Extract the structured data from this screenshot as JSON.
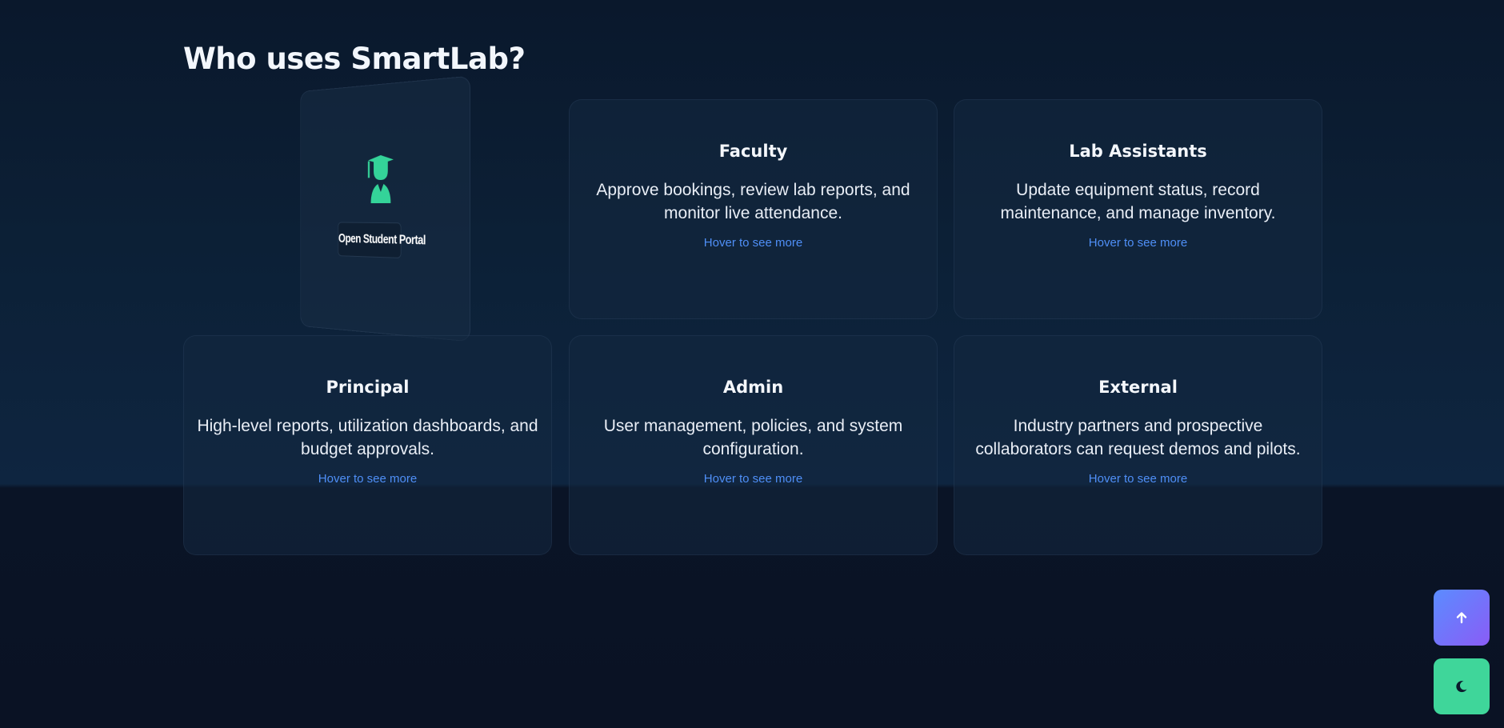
{
  "section": {
    "title": "Who uses SmartLab?"
  },
  "student_card": {
    "icon": "student-graduate-icon",
    "button_label": "Open Student Portal",
    "accent": "#34d399"
  },
  "cards": [
    {
      "title": "Faculty",
      "description": "Approve bookings, review lab reports, and monitor live attendance.",
      "hint": "Hover to see more"
    },
    {
      "title": "Lab Assistants",
      "description": "Update equipment status, record maintenance, and manage inventory.",
      "hint": "Hover to see more"
    },
    {
      "title": "Principal",
      "description": "High-level reports, utilization dashboards, and budget approvals.",
      "hint": "Hover to see more"
    },
    {
      "title": "Admin",
      "description": "User management, policies, and system configuration.",
      "hint": "Hover to see more"
    },
    {
      "title": "External",
      "description": "Industry partners and prospective collaborators can request demos and pilots.",
      "hint": "Hover to see more"
    }
  ],
  "floating_buttons": {
    "scroll_top_icon": "arrow-up-icon",
    "theme_toggle_icon": "moon-icon"
  },
  "colors": {
    "background": "#0a1428",
    "hint_link": "#4f8ff7",
    "scroll_top_gradient": [
      "#5b8cff",
      "#8a5cf6"
    ],
    "theme_toggle": "#3fd69a"
  }
}
